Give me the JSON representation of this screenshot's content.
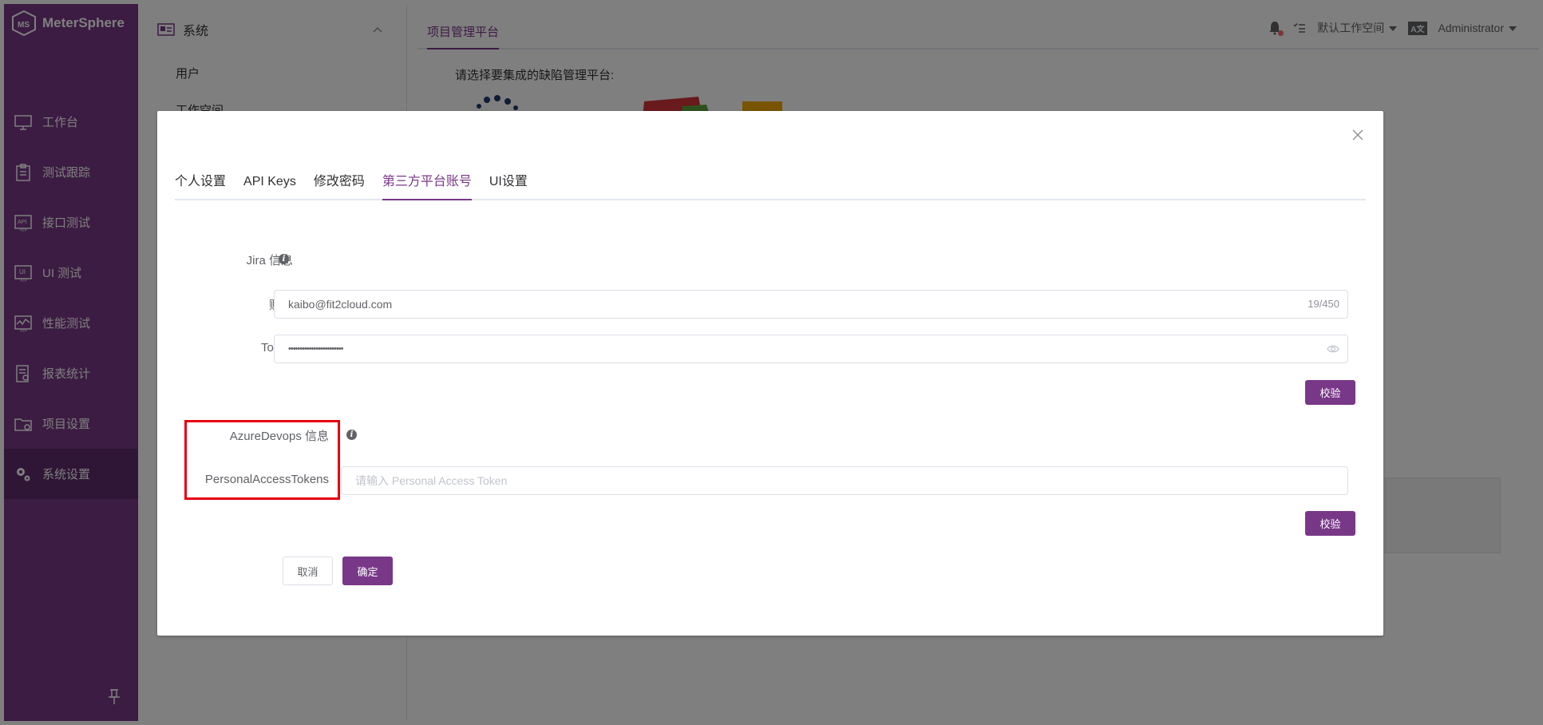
{
  "app": {
    "name": "MeterSphere"
  },
  "nav": {
    "items": [
      {
        "label": "工作台",
        "icon": "desktop-icon"
      },
      {
        "label": "测试跟踪",
        "icon": "clipboard-icon"
      },
      {
        "label": "接口测试",
        "icon": "api-icon"
      },
      {
        "label": "UI 测试",
        "icon": "ui-icon"
      },
      {
        "label": "性能测试",
        "icon": "performance-icon"
      },
      {
        "label": "报表统计",
        "icon": "report-icon"
      },
      {
        "label": "项目设置",
        "icon": "project-folder-icon"
      },
      {
        "label": "系统设置",
        "icon": "gears-icon",
        "active": true
      }
    ]
  },
  "system_menu": {
    "title": "系统",
    "items": [
      "用户",
      "工作空间"
    ]
  },
  "main": {
    "tab": "项目管理平台",
    "prompt": "请选择要集成的缺陷管理平台:"
  },
  "header": {
    "workspace": "默认工作空间",
    "language_badge": "A文",
    "user": "Administrator"
  },
  "modal": {
    "tabs": [
      {
        "label": "个人设置"
      },
      {
        "label": "API Keys"
      },
      {
        "label": "修改密码"
      },
      {
        "label": "第三方平台账号",
        "active": true
      },
      {
        "label": "UI设置"
      }
    ],
    "jira": {
      "section_label": "Jira 信息",
      "account_label": "账号",
      "account_value": "kaibo@fit2cloud.com",
      "account_count": "19/450",
      "token_label": "Token",
      "token_value": "••••••••••••••••••••••••",
      "verify_label": "校验"
    },
    "azure": {
      "section_label": "AzureDevops 信息",
      "pat_label": "PersonalAccessTokens",
      "pat_placeholder": "请输入 Personal Access Token",
      "verify_label": "校验"
    },
    "cancel_label": "取消",
    "confirm_label": "确定"
  },
  "colors": {
    "brand": "#783887",
    "brand_dark": "#5f2a6c",
    "highlight": "#e60012"
  }
}
